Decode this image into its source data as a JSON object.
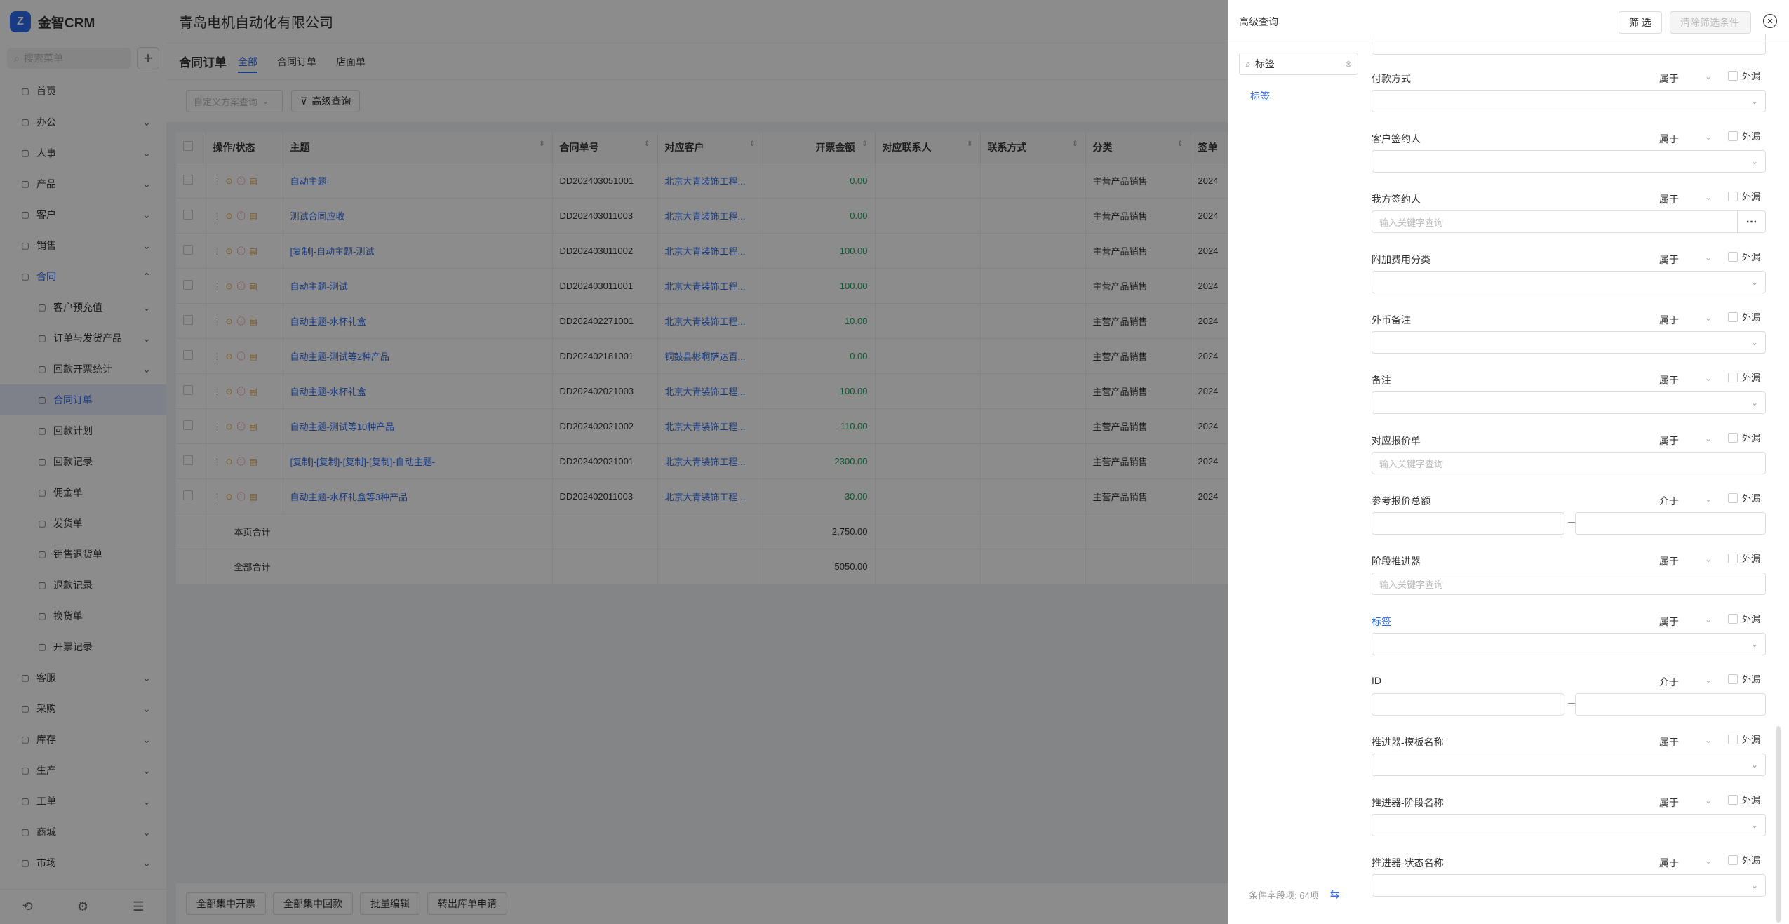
{
  "app": {
    "name": "金智CRM",
    "logo": "CRM",
    "company": "青岛电机自动化有限公司"
  },
  "sidebar": {
    "search_placeholder": "搜索菜单",
    "items": [
      {
        "label": "首页",
        "icon": "home-icon",
        "type": "top"
      },
      {
        "label": "办公",
        "icon": "office-icon",
        "type": "top",
        "chev": "⌄"
      },
      {
        "label": "人事",
        "icon": "person-icon",
        "type": "top",
        "chev": "⌄"
      },
      {
        "label": "产品",
        "icon": "product-icon",
        "type": "top",
        "chev": "⌄"
      },
      {
        "label": "客户",
        "icon": "customer-icon",
        "type": "top",
        "chev": "⌄"
      },
      {
        "label": "销售",
        "icon": "sales-icon",
        "type": "top",
        "chev": "⌄"
      },
      {
        "label": "合同",
        "icon": "contract-icon",
        "type": "open",
        "chev": "⌃"
      },
      {
        "label": "客户预充值",
        "icon": "doc-icon",
        "type": "sub",
        "chev": "⌄"
      },
      {
        "label": "订单与发货产品",
        "icon": "doc-icon",
        "type": "sub",
        "chev": "⌄"
      },
      {
        "label": "回款开票统计",
        "icon": "doc-icon",
        "type": "sub",
        "chev": "⌄"
      },
      {
        "label": "合同订单",
        "icon": "doc-icon",
        "type": "active"
      },
      {
        "label": "回款计划",
        "icon": "doc-icon",
        "type": "sub"
      },
      {
        "label": "回款记录",
        "icon": "doc-icon",
        "type": "sub"
      },
      {
        "label": "佣金单",
        "icon": "doc-icon",
        "type": "sub"
      },
      {
        "label": "发货单",
        "icon": "doc-icon",
        "type": "sub"
      },
      {
        "label": "销售退货单",
        "icon": "doc-icon",
        "type": "sub"
      },
      {
        "label": "退款记录",
        "icon": "doc-icon",
        "type": "sub"
      },
      {
        "label": "换货单",
        "icon": "doc-icon",
        "type": "sub"
      },
      {
        "label": "开票记录",
        "icon": "doc-icon",
        "type": "sub"
      },
      {
        "label": "客服",
        "icon": "service-icon",
        "type": "top",
        "chev": "⌄"
      },
      {
        "label": "采购",
        "icon": "purchase-icon",
        "type": "top",
        "chev": "⌄"
      },
      {
        "label": "库存",
        "icon": "stock-icon",
        "type": "top",
        "chev": "⌄"
      },
      {
        "label": "生产",
        "icon": "production-icon",
        "type": "top",
        "chev": "⌄"
      },
      {
        "label": "工单",
        "icon": "workorder-icon",
        "type": "top",
        "chev": "⌄"
      },
      {
        "label": "商城",
        "icon": "mall-icon",
        "type": "top",
        "chev": "⌄"
      },
      {
        "label": "市场",
        "icon": "market-icon",
        "type": "top",
        "chev": "⌄"
      }
    ]
  },
  "page": {
    "title": "合同订单",
    "tabs": [
      "全部",
      "合同订单",
      "店面单"
    ],
    "scheme_placeholder": "自定义方案查询",
    "adv_button": "高级查询"
  },
  "table": {
    "headers": [
      "操作/状态",
      "主题",
      "合同单号",
      "对应客户",
      "开票金额",
      "对应联系人",
      "联系方式",
      "分类",
      "签单"
    ],
    "rows": [
      {
        "subject": "自动主题-",
        "no": "DD202403051001",
        "customer": "北京大青装饰工程...",
        "amount": "0.00",
        "category": "主营产品销售",
        "date": "2024"
      },
      {
        "subject": "测试合同应收",
        "no": "DD202403011003",
        "customer": "北京大青装饰工程...",
        "amount": "0.00",
        "category": "主营产品销售",
        "date": "2024"
      },
      {
        "subject": "[复制]-自动主题-测试",
        "no": "DD202403011002",
        "customer": "北京大青装饰工程...",
        "amount": "100.00",
        "category": "主营产品销售",
        "date": "2024"
      },
      {
        "subject": "自动主题-测试",
        "no": "DD202403011001",
        "customer": "北京大青装饰工程...",
        "amount": "100.00",
        "category": "主营产品销售",
        "date": "2024"
      },
      {
        "subject": "自动主题-水杯礼盒",
        "no": "DD202402271001",
        "customer": "北京大青装饰工程...",
        "amount": "10.00",
        "category": "主营产品销售",
        "date": "2024"
      },
      {
        "subject": "自动主题-测试等2种产品",
        "no": "DD202402181001",
        "customer": "铜鼓县彬啊萨达百...",
        "amount": "0.00",
        "category": "主营产品销售",
        "date": "2024"
      },
      {
        "subject": "自动主题-水杯礼盒",
        "no": "DD202402021003",
        "customer": "北京大青装饰工程...",
        "amount": "100.00",
        "category": "主营产品销售",
        "date": "2024"
      },
      {
        "subject": "自动主题-测试等10种产品",
        "no": "DD202402021002",
        "customer": "北京大青装饰工程...",
        "amount": "110.00",
        "category": "主营产品销售",
        "date": "2024"
      },
      {
        "subject": "[复制]-[复制]-[复制]-[复制]-自动主题-",
        "no": "DD202402021001",
        "customer": "北京大青装饰工程...",
        "amount": "2300.00",
        "category": "主营产品销售",
        "date": "2024"
      },
      {
        "subject": "自动主题-水杯礼盒等3种产品",
        "no": "DD202402011003",
        "customer": "北京大青装饰工程...",
        "amount": "30.00",
        "category": "主营产品销售",
        "date": "2024"
      }
    ],
    "page_total_label": "本页合计",
    "page_total": "2,750.00",
    "all_total_label": "全部合计",
    "all_total": "5050.00"
  },
  "bottom_actions": [
    "全部集中开票",
    "全部集中回款",
    "批量编辑",
    "转出库单申请"
  ],
  "drawer": {
    "title": "高级查询",
    "filter_btn": "筛 选",
    "clear_btn": "清除筛选条件",
    "tag_search_value": "标签",
    "tag_link": "标签",
    "footer_count": "条件字段项: 64项",
    "fields": [
      {
        "label": "付款方式",
        "op": "属于",
        "kind": "select",
        "placeholder": ""
      },
      {
        "label": "客户签约人",
        "op": "属于",
        "kind": "select",
        "placeholder": ""
      },
      {
        "label": "我方签约人",
        "op": "属于",
        "kind": "lookup",
        "placeholder": "输入关键字查询"
      },
      {
        "label": "附加费用分类",
        "op": "属于",
        "kind": "select",
        "placeholder": ""
      },
      {
        "label": "外币备注",
        "op": "属于",
        "kind": "select",
        "placeholder": ""
      },
      {
        "label": "备注",
        "op": "属于",
        "kind": "select",
        "placeholder": ""
      },
      {
        "label": "对应报价单",
        "op": "属于",
        "kind": "text",
        "placeholder": "输入关键字查询"
      },
      {
        "label": "参考报价总额",
        "op": "介于",
        "kind": "range",
        "placeholder": ""
      },
      {
        "label": "阶段推进器",
        "op": "属于",
        "kind": "text",
        "placeholder": "输入关键字查询"
      },
      {
        "label": "标签",
        "op": "属于",
        "kind": "select",
        "placeholder": "",
        "highlight": true
      },
      {
        "label": "ID",
        "op": "介于",
        "kind": "range",
        "placeholder": ""
      },
      {
        "label": "推进器-模板名称",
        "op": "属于",
        "kind": "select",
        "placeholder": ""
      },
      {
        "label": "推进器-阶段名称",
        "op": "属于",
        "kind": "select",
        "placeholder": ""
      },
      {
        "label": "推进器-状态名称",
        "op": "属于",
        "kind": "select",
        "placeholder": ""
      }
    ],
    "wai_label": "外漏"
  }
}
